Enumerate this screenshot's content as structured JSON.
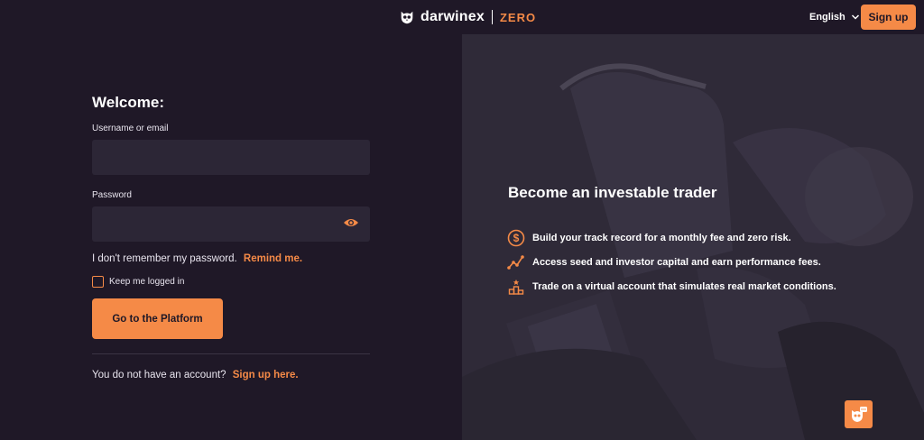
{
  "header": {
    "brand": "darwinex",
    "brand_suffix": "ZERO",
    "language": "English",
    "signup_label": "Sign up"
  },
  "login": {
    "welcome": "Welcome:",
    "username_label": "Username or email",
    "username_value": "",
    "password_label": "Password",
    "password_value": "",
    "forgot_text": "I don't remember my password.",
    "remind_link": "Remind me.",
    "keep_logged_label": "Keep me logged in",
    "keep_logged_checked": false,
    "submit_label": "Go to the Platform",
    "no_account_text": "You do not have an account?",
    "signup_link": "Sign up here."
  },
  "promo": {
    "title": "Become an investable trader",
    "bullets": [
      {
        "icon": "dollar-circle-icon",
        "text": "Build your track record for a monthly fee and zero risk."
      },
      {
        "icon": "growth-chart-icon",
        "text": "Access seed and investor capital and earn performance fees."
      },
      {
        "icon": "podium-icon",
        "text": "Trade on a virtual account that simulates real market conditions."
      }
    ]
  },
  "colors": {
    "accent": "#f58a47",
    "background": "#1f1827",
    "field": "#2c2636"
  }
}
